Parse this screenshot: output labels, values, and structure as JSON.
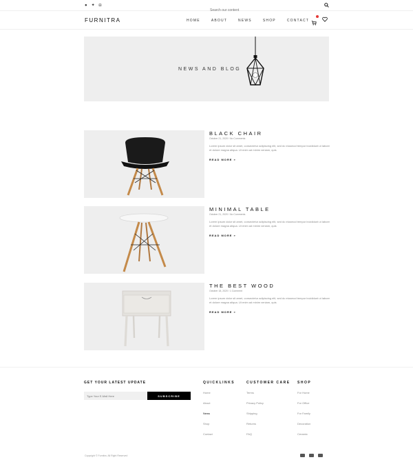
{
  "topbar": {
    "social_icons": [
      "facebook-icon",
      "twitter-icon",
      "instagram-icon"
    ],
    "search_placeholder": "Search our content"
  },
  "header": {
    "logo": "FURNITRA",
    "nav": [
      "HOME",
      "ABOUT",
      "NEWS",
      "SHOP",
      "CONTACT"
    ],
    "cart_badge_color": "#e53935"
  },
  "hero": {
    "title": "NEWS AND BLOG"
  },
  "posts": [
    {
      "title": "BLACK CHAIR",
      "meta": "October 21, 2020 / No Comments",
      "excerpt": "Lorem ipsum dolor sit amet, consectetur adipiscing elit, sed do eiusmod tempor incididunt ut labore et dolore magna aliqua. Ut enim ad minim veniam, quis",
      "read_more": "READ MORE »"
    },
    {
      "title": "MINIMAL TABLE",
      "meta": "October 21, 2020 / No Comments",
      "excerpt": "Lorem ipsum dolor sit amet, consectetur adipiscing elit, sed do eiusmod tempor incididunt ut labore et dolore magna aliqua. Ut enim ad minim veniam, quis",
      "read_more": "READ MORE »"
    },
    {
      "title": "THE BEST WOOD",
      "meta": "October 18, 2020 / 1 Comment",
      "excerpt": "Lorem ipsum dolor sit amet, consectetur adipiscing elit, sed do eiusmod tempor incididunt ut labore et dolore magna aliqua. Ut enim ad minim veniam, quis",
      "read_more": "READ MORE »"
    }
  ],
  "footer": {
    "newsletter_title": "GET YOUR LATEST UPDATE",
    "email_placeholder": "Type Your E-Mail Here",
    "subscribe_label": "SUBSCRIBE",
    "quicklinks": {
      "title": "QUICKLINKS",
      "links": [
        "Home",
        "About",
        "News",
        "Shop",
        "Contact"
      ]
    },
    "customer_care": {
      "title": "CUSTOMER CARE",
      "links": [
        "Terms",
        "Privacy Policy",
        "Shipping",
        "Returns",
        "FAQ"
      ]
    },
    "shop": {
      "title": "SHOP",
      "links": [
        "For Home",
        "For Office",
        "For Family",
        "Decoration",
        "Ceramic"
      ]
    },
    "copyright": "Copyright © Furnitra. All Right Reserved",
    "payment_icons": [
      "card-icon",
      "card-icon",
      "card-icon"
    ]
  }
}
